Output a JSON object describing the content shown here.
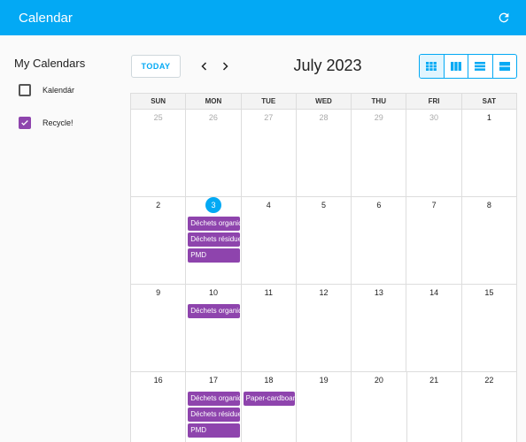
{
  "app": {
    "title": "Calendar"
  },
  "sidebar": {
    "heading": "My Calendars",
    "calendars": [
      {
        "label": "Kalendár",
        "checked": false
      },
      {
        "label": "Recycle!",
        "checked": true,
        "color": "#8e44ad"
      }
    ]
  },
  "toolbar": {
    "today_label": "TODAY",
    "month_title": "July 2023",
    "views": [
      "month-view",
      "week-view",
      "day-view",
      "list-view"
    ]
  },
  "calendar": {
    "weekdays": [
      "SUN",
      "MON",
      "TUE",
      "WED",
      "THU",
      "FRI",
      "SAT"
    ],
    "weeks": [
      [
        {
          "n": "25",
          "other": true
        },
        {
          "n": "26",
          "other": true
        },
        {
          "n": "27",
          "other": true
        },
        {
          "n": "28",
          "other": true
        },
        {
          "n": "29",
          "other": true
        },
        {
          "n": "30",
          "other": true
        },
        {
          "n": "1"
        }
      ],
      [
        {
          "n": "2"
        },
        {
          "n": "3",
          "today": true,
          "events": [
            "Déchets organiques",
            "Déchets résiduels",
            "PMD"
          ]
        },
        {
          "n": "4"
        },
        {
          "n": "5"
        },
        {
          "n": "6"
        },
        {
          "n": "7"
        },
        {
          "n": "8"
        }
      ],
      [
        {
          "n": "9"
        },
        {
          "n": "10",
          "events": [
            "Déchets organiques"
          ]
        },
        {
          "n": "11"
        },
        {
          "n": "12"
        },
        {
          "n": "13"
        },
        {
          "n": "14"
        },
        {
          "n": "15"
        }
      ],
      [
        {
          "n": "16"
        },
        {
          "n": "17",
          "events": [
            "Déchets organiques",
            "Déchets résiduels",
            "PMD"
          ]
        },
        {
          "n": "18",
          "events": [
            "Paper-cardboard"
          ]
        },
        {
          "n": "19"
        },
        {
          "n": "20"
        },
        {
          "n": "21"
        },
        {
          "n": "22"
        }
      ]
    ]
  },
  "colors": {
    "primary": "#03a9f4",
    "event": "#8e44ad"
  }
}
